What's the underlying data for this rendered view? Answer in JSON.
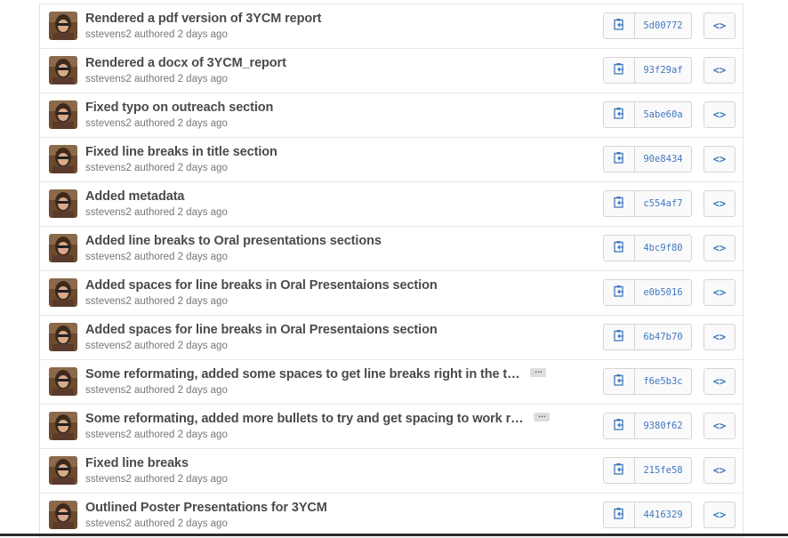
{
  "colors": {
    "link": "#4078c0",
    "title": "#4a4a4a",
    "meta": "#777777"
  },
  "commits": [
    {
      "title": "Rendered a pdf version of 3YCM report",
      "author": "sstevens2",
      "meta": "authored 2 days ago",
      "sha": "5d00772",
      "truncated": false
    },
    {
      "title": "Rendered a docx of 3YCM_report",
      "author": "sstevens2",
      "meta": "authored 2 days ago",
      "sha": "93f29af",
      "truncated": false
    },
    {
      "title": "Fixed typo on outreach section",
      "author": "sstevens2",
      "meta": "authored 2 days ago",
      "sha": "5abe60a",
      "truncated": false
    },
    {
      "title": "Fixed line breaks in title section",
      "author": "sstevens2",
      "meta": "authored 2 days ago",
      "sha": "90e8434",
      "truncated": false
    },
    {
      "title": "Added metadata",
      "author": "sstevens2",
      "meta": "authored 2 days ago",
      "sha": "c554af7",
      "truncated": false
    },
    {
      "title": "Added line breaks to Oral presentations sections",
      "author": "sstevens2",
      "meta": "authored 2 days ago",
      "sha": "4bc9f80",
      "truncated": false
    },
    {
      "title": "Added spaces for line breaks in Oral Presentaions section",
      "author": "sstevens2",
      "meta": "authored 2 days ago",
      "sha": "e0b5016",
      "truncated": false
    },
    {
      "title": "Added spaces for line breaks in Oral Presentaions section",
      "author": "sstevens2",
      "meta": "authored 2 days ago",
      "sha": "6b47b70",
      "truncated": false
    },
    {
      "title": "Some reformating, added some spaces to get line breaks right in the t…",
      "author": "sstevens2",
      "meta": "authored 2 days ago",
      "sha": "f6e5b3c",
      "truncated": true
    },
    {
      "title": "Some reformating, added more bullets to try and get spacing to work r…",
      "author": "sstevens2",
      "meta": "authored 2 days ago",
      "sha": "9380f62",
      "truncated": true
    },
    {
      "title": "Fixed line breaks",
      "author": "sstevens2",
      "meta": "authored 2 days ago",
      "sha": "215fe58",
      "truncated": false
    },
    {
      "title": "Outlined Poster Presentations for 3YCM",
      "author": "sstevens2",
      "meta": "authored 2 days ago",
      "sha": "4416329",
      "truncated": false
    }
  ],
  "icons": {
    "copy": "clippy-icon",
    "browse": "code-icon",
    "expand": "ellipsis-icon"
  },
  "labels": {
    "ellipsis": "…",
    "browse": "<>"
  }
}
